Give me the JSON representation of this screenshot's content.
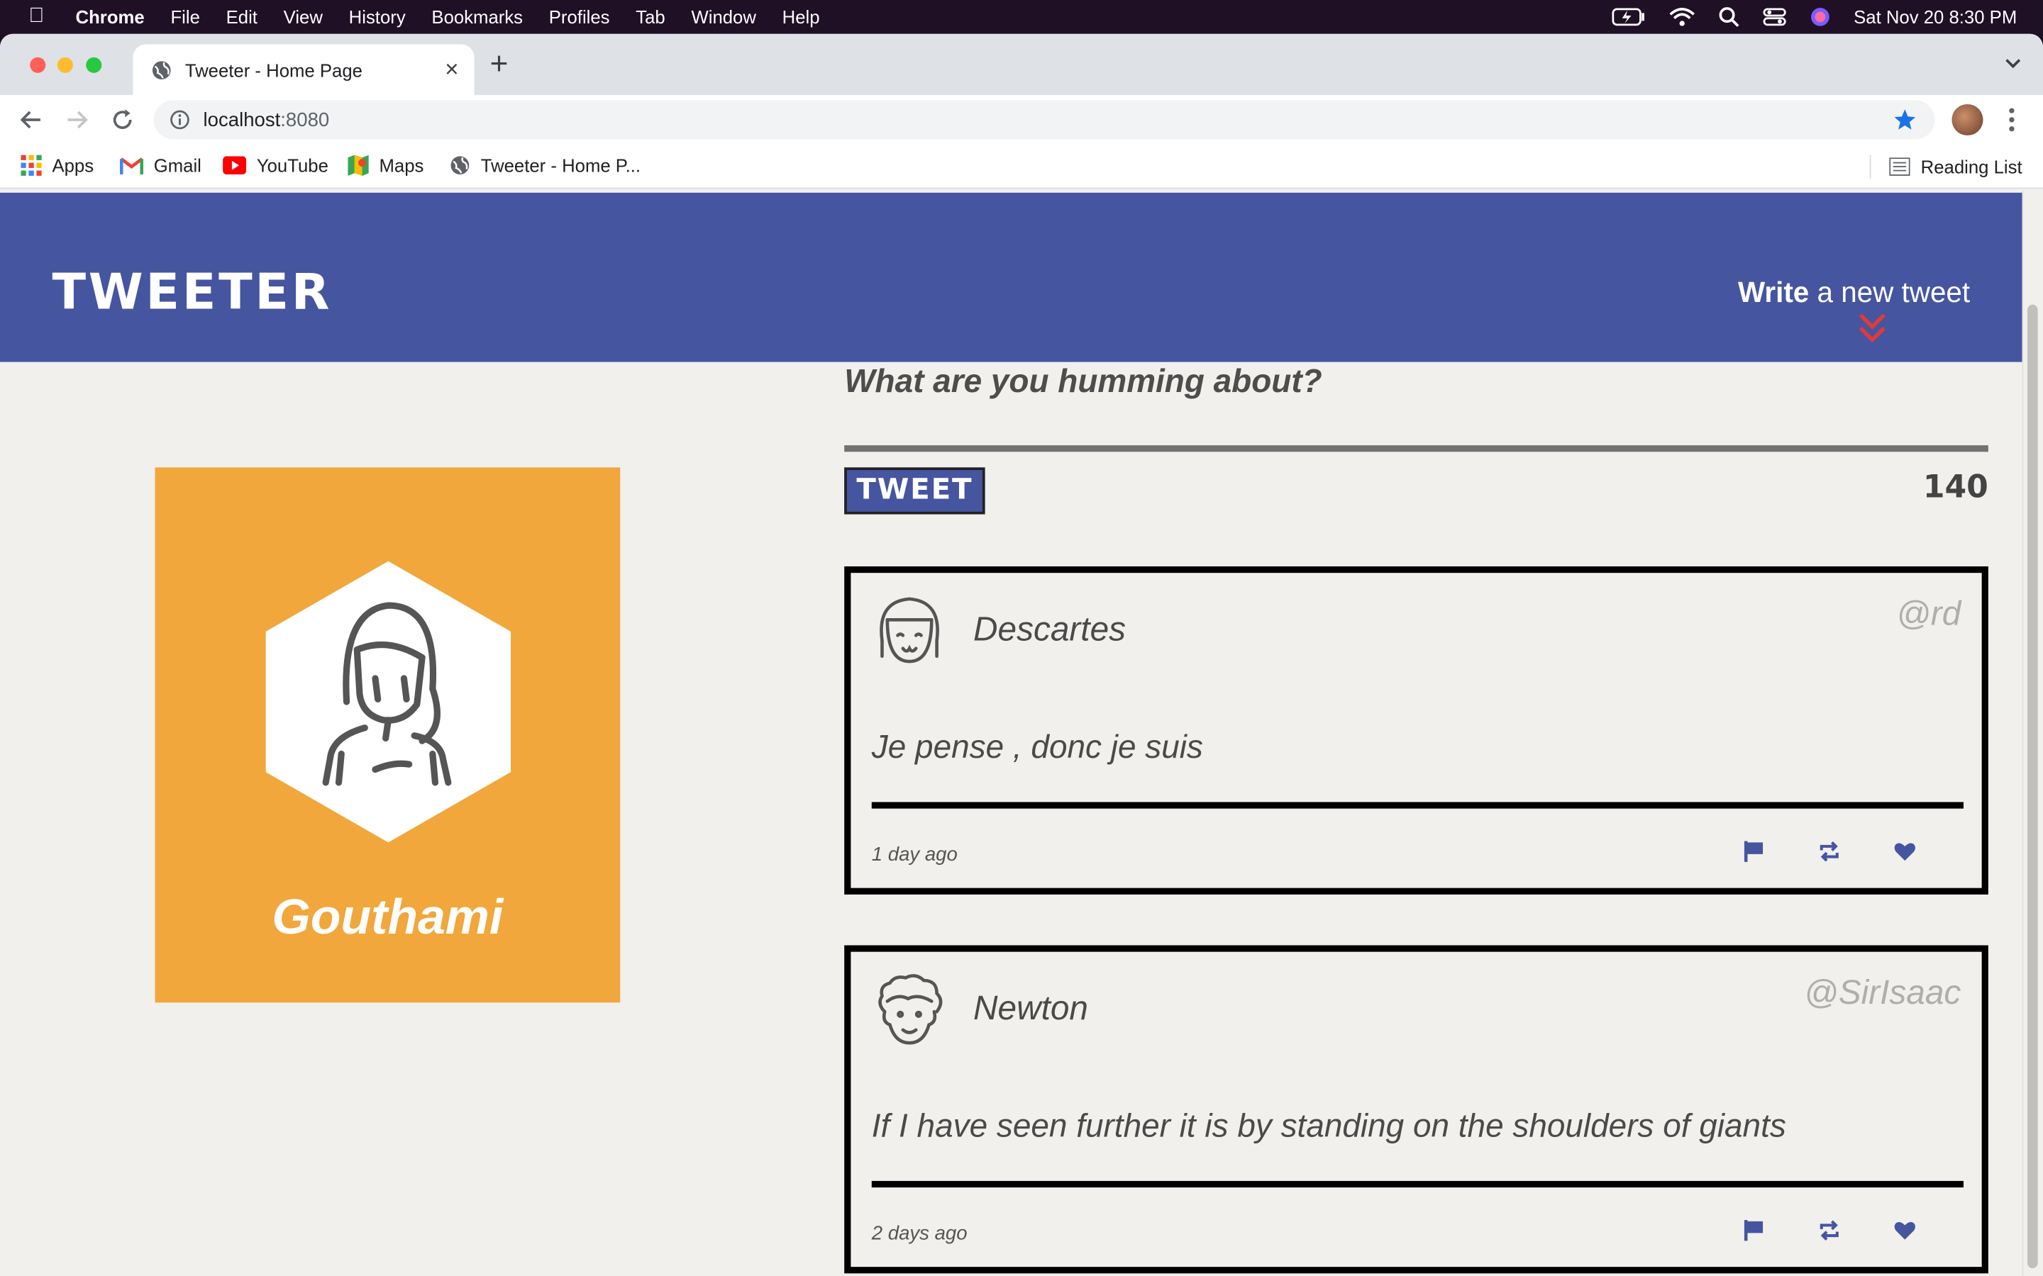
{
  "menubar": {
    "app_name": "Chrome",
    "menus": [
      "File",
      "Edit",
      "View",
      "History",
      "Bookmarks",
      "Profiles",
      "Tab",
      "Window",
      "Help"
    ],
    "clock": "Sat Nov 20  8:30 PM"
  },
  "browser": {
    "tab_title": "Tweeter - Home Page",
    "url_host": "localhost",
    "url_port": ":8080",
    "bookmarks": [
      "Apps",
      "Gmail",
      "YouTube",
      "Maps",
      "Tweeter - Home P..."
    ],
    "reading_list": "Reading List"
  },
  "header": {
    "logo": "TWEETER",
    "write_bold": "Write",
    "write_rest": " a new tweet",
    "accent": "#4655a0"
  },
  "profile": {
    "name": "Gouthami",
    "card_color": "#f1a73b",
    "avatar_icon": "woman-avatar-icon"
  },
  "compose": {
    "prompt": "What are you humming about?",
    "button_label": "TWEET",
    "char_count": "140"
  },
  "tweets": [
    {
      "name": "Descartes",
      "handle": "@rd",
      "text": "Je pense , donc je suis",
      "time": "1 day ago",
      "avatar_icon": "girl-avatar-icon"
    },
    {
      "name": "Newton",
      "handle": "@SirIsaac",
      "text": "If I have seen further it is by standing on the shoulders of giants",
      "time": "2 days ago",
      "avatar_icon": "curly-hair-avatar-icon"
    }
  ]
}
